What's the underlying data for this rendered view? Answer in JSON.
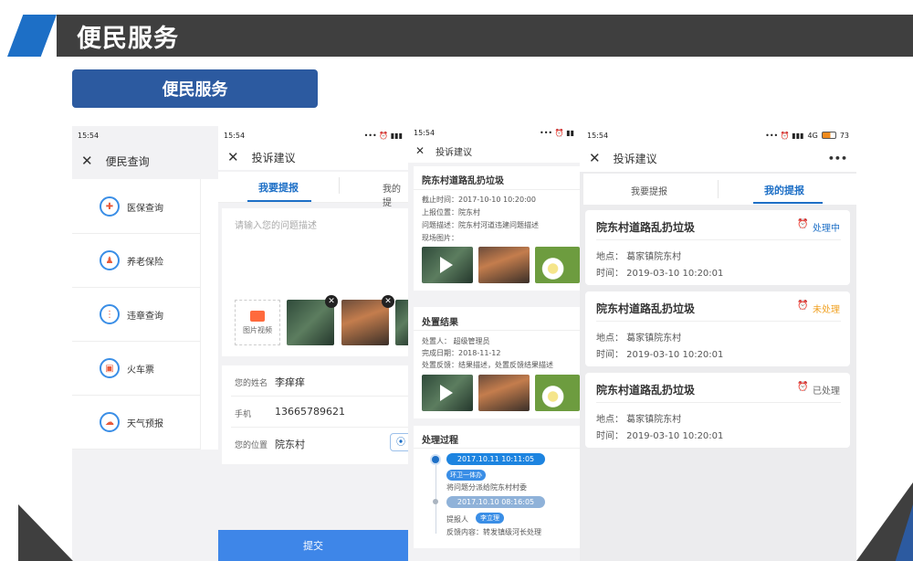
{
  "header": {
    "title": "便民服务",
    "pill": "便民服务"
  },
  "p1": {
    "time": "15:54",
    "title": "便民查询",
    "items": [
      {
        "icon": "medical-insurance-icon",
        "label": "医保查询"
      },
      {
        "icon": "pension-icon",
        "label": "养老保险"
      },
      {
        "icon": "traffic-light-icon",
        "label": "违章查询"
      },
      {
        "icon": "train-icon",
        "label": "火车票"
      },
      {
        "icon": "weather-icon",
        "label": "天气预报"
      }
    ]
  },
  "p2": {
    "time": "15:54",
    "title": "投诉建议",
    "tab_active": "我要提报",
    "tab_other": "我的提",
    "placeholder": "请输入您的问题描述",
    "upload": "图片视频",
    "name_label": "您的姓名",
    "name": "李痒痒",
    "phone_label": "手机",
    "phone": "13665789621",
    "loc_label": "您的位置",
    "loc": "院东村",
    "submit": "提交"
  },
  "p3": {
    "time": "15:54",
    "title": "投诉建议",
    "case_title": "院东村道路乱扔垃圾",
    "deadline": "截止时间：2017-10-10  10:20:00",
    "report_loc": "上报位置：院东村",
    "desc": "问题描述：院东村河道违建问题描述",
    "photos": "现场图片：",
    "result_title": "处置结果",
    "handler": "处置人：  超级管理员",
    "done_date": "完成日期：2018-11-12",
    "feedback": "处置反馈：结果描述，处置反馈结果描述",
    "process_title": "处理过程",
    "step1_time": "2017.10.11  10:11:05",
    "step1_tag": "环卫一体办",
    "step1_text": "将问题分派给院东村村委",
    "step2_time": "2017.10.10  08:16:05",
    "step2_label": "提报人",
    "step2_tag": "李立理",
    "step2_text": "反馈内容：转发镇级河长处理"
  },
  "p4": {
    "time": "15:54",
    "battery": "73",
    "network": "4G",
    "title": "投诉建议",
    "more": "•••",
    "tab_other": "我要提报",
    "tab_active": "我的提报",
    "cards": [
      {
        "title": "院东村道路乱扔垃圾",
        "status": "处理中",
        "status_color": "#1d6fc6",
        "place": "地点：  葛家镇院东村",
        "time": "时间：  2019-03-10 10:20:01"
      },
      {
        "title": "院东村道路乱扔垃圾",
        "status": "未处理",
        "status_color": "#f0a020",
        "place": "地点：  葛家镇院东村",
        "time": "时间：  2019-03-10 10:20:01"
      },
      {
        "title": "院东村道路乱扔垃圾",
        "status": "已处理",
        "status_color": "#666666",
        "place": "地点：  葛家镇院东村",
        "time": "时间：  2019-03-10 10:20:01"
      }
    ]
  }
}
